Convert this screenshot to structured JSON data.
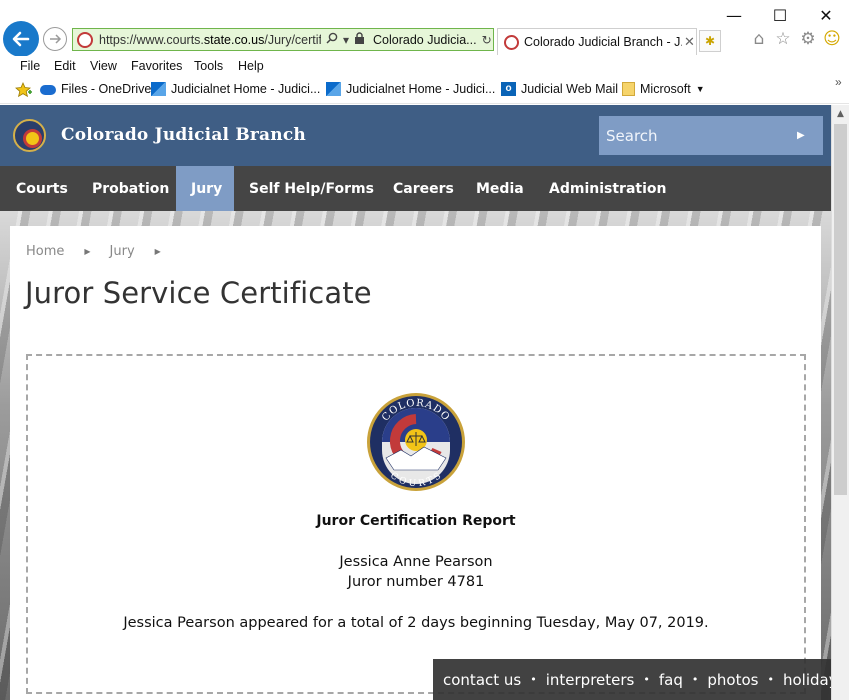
{
  "browser": {
    "address": {
      "url_prefix": "https://www.courts.",
      "url_domain": "state.co.us",
      "url_rest": "/Jury/certif",
      "site_identity": "Colorado Judicia..."
    },
    "tab": {
      "title": "Colorado Judicial Branch - J..."
    },
    "menu": [
      "File",
      "Edit",
      "View",
      "Favorites",
      "Tools",
      "Help"
    ],
    "favorites": [
      {
        "label": "Files - OneDrive",
        "icon": "onedrive-icon"
      },
      {
        "label": "Judicialnet Home - Judici...",
        "icon": "sharepoint-icon"
      },
      {
        "label": "Judicialnet Home - Judici...",
        "icon": "sharepoint-icon"
      },
      {
        "label": "Judicial Web Mail",
        "icon": "outlook-icon"
      },
      {
        "label": "Microsoft",
        "icon": "folder-icon"
      }
    ]
  },
  "site": {
    "name": "Colorado Judicial Branch",
    "search_placeholder": "Search",
    "nav": [
      {
        "label": "Courts",
        "active": false
      },
      {
        "label": "Probation",
        "active": false
      },
      {
        "label": "Jury",
        "active": true
      },
      {
        "label": "Self Help/Forms",
        "active": false
      },
      {
        "label": "Careers",
        "active": false
      },
      {
        "label": "Media",
        "active": false
      },
      {
        "label": "Administration",
        "active": false
      }
    ],
    "breadcrumb": [
      "Home",
      "Jury"
    ],
    "page_title": "Juror Service Certificate",
    "certificate": {
      "seal_top": "COLORADO",
      "seal_bottom": "COURTS",
      "report_title": "Juror Certification Report",
      "juror_name": "Jessica Anne Pearson",
      "juror_number": "Juror number 4781",
      "summary": "Jessica Pearson appeared for a total of 2 days beginning Tuesday, May 07, 2019."
    },
    "footer_links": [
      "contact us",
      "interpreters",
      "faq",
      "photos",
      "holidays"
    ]
  },
  "colors": {
    "header_blue": "#3f5e85",
    "nav_gray": "#454545",
    "accent_blue": "#7f9cc5",
    "seal_red": "#c23a3a",
    "seal_gold": "#f2c417"
  }
}
